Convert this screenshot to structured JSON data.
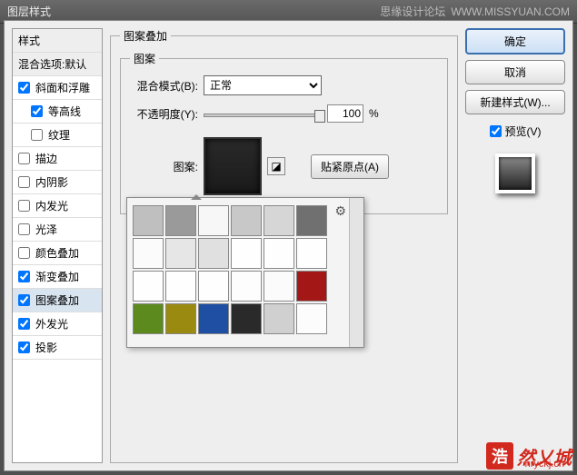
{
  "titlebar": {
    "title": "图层样式",
    "forum": "思缘设计论坛",
    "url": "WWW.MISSYUAN.COM"
  },
  "sidebar": {
    "style_header": "样式",
    "blend_header": "混合选项:默认",
    "items": [
      {
        "label": "斜面和浮雕",
        "checked": true
      },
      {
        "label": "等高线",
        "checked": true,
        "indent": true
      },
      {
        "label": "纹理",
        "checked": false,
        "indent": true
      },
      {
        "label": "描边",
        "checked": false
      },
      {
        "label": "内阴影",
        "checked": false
      },
      {
        "label": "内发光",
        "checked": false
      },
      {
        "label": "光泽",
        "checked": false
      },
      {
        "label": "颜色叠加",
        "checked": false
      },
      {
        "label": "渐变叠加",
        "checked": true
      },
      {
        "label": "图案叠加",
        "checked": true,
        "selected": true
      },
      {
        "label": "外发光",
        "checked": true
      },
      {
        "label": "投影",
        "checked": true
      }
    ]
  },
  "main": {
    "group_title": "图案叠加",
    "inner_title": "图案",
    "blend_label": "混合模式(B):",
    "blend_value": "正常",
    "opacity_label": "不透明度(Y):",
    "opacity_value": "100",
    "opacity_unit": "%",
    "pattern_label": "图案:",
    "snap_label": "贴紧原点(A)"
  },
  "swatches": [
    "#bfbfbf",
    "#9a9a9a",
    "#f7f7f7",
    "#c8c8c8",
    "#d6d6d6",
    "#707070",
    "#fbfbfb",
    "#e6e6e6",
    "#e0e0e0",
    "#fefefe",
    "#fefefe",
    "#fefefe",
    "#fefefe",
    "#fefefe",
    "#fefefe",
    "#fdfdfd",
    "#fbfbfb",
    "#a31717",
    "#5d8a1e",
    "#9a8a10",
    "#1e4fa3",
    "#2a2a2a",
    "#d0d0d0",
    "#fcfcfc"
  ],
  "rpanel": {
    "ok": "确定",
    "cancel": "取消",
    "newstyle": "新建样式(W)...",
    "preview": "预览(V)"
  },
  "watermark": {
    "block": "浩",
    "text": "然乂城",
    "url": "hryckj.cn"
  }
}
